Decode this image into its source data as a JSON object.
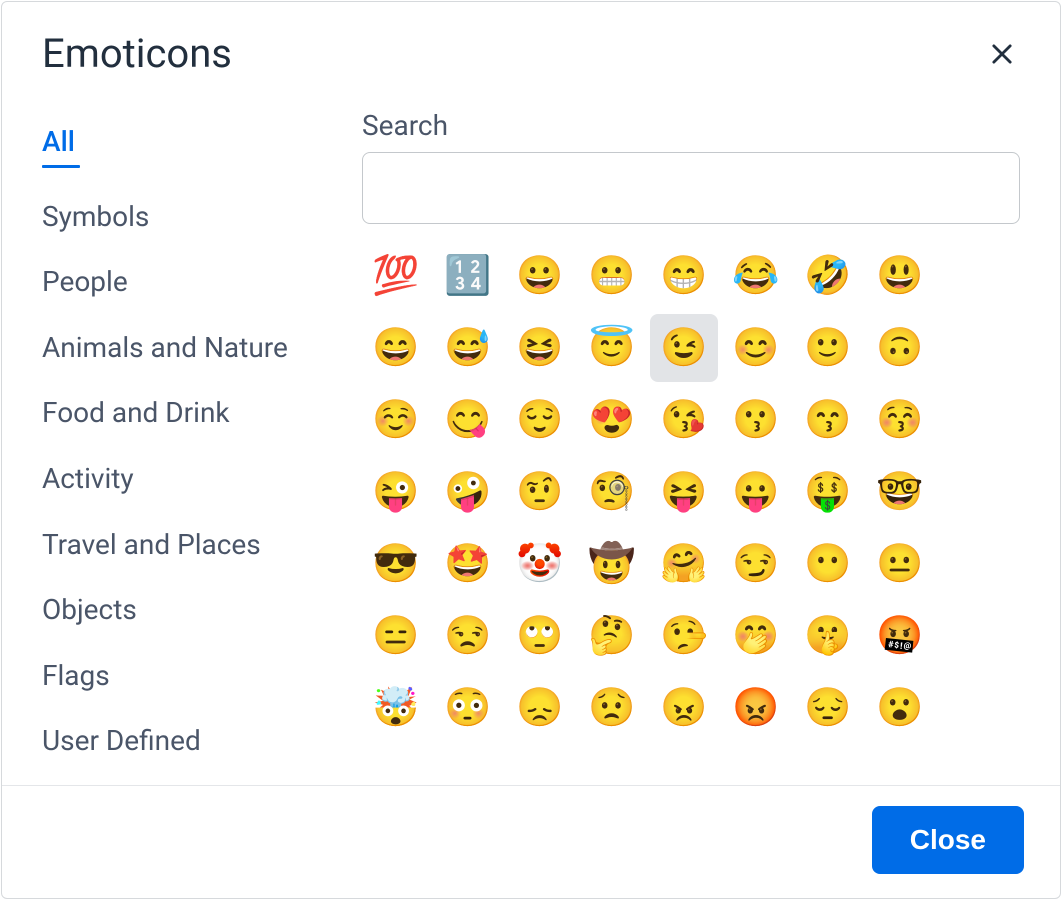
{
  "dialog": {
    "title": "Emoticons",
    "close_button_label": "Close"
  },
  "sidebar": {
    "tabs": [
      {
        "label": "All",
        "active": true
      },
      {
        "label": "Symbols",
        "active": false
      },
      {
        "label": "People",
        "active": false
      },
      {
        "label": "Animals and Nature",
        "active": false
      },
      {
        "label": "Food and Drink",
        "active": false
      },
      {
        "label": "Activity",
        "active": false
      },
      {
        "label": "Travel and Places",
        "active": false
      },
      {
        "label": "Objects",
        "active": false
      },
      {
        "label": "Flags",
        "active": false
      },
      {
        "label": "User Defined",
        "active": false
      }
    ]
  },
  "search": {
    "label": "Search",
    "value": ""
  },
  "emoji_grid": {
    "highlighted_index": 12,
    "items": [
      {
        "char": "💯",
        "name": "hundred-points"
      },
      {
        "char": "🔢",
        "name": "input-numbers"
      },
      {
        "char": "😀",
        "name": "grinning-face"
      },
      {
        "char": "😬",
        "name": "grimacing-face"
      },
      {
        "char": "😁",
        "name": "beaming-face"
      },
      {
        "char": "😂",
        "name": "face-with-tears-of-joy"
      },
      {
        "char": "🤣",
        "name": "rolling-on-the-floor-laughing"
      },
      {
        "char": "😃",
        "name": "grinning-face-big-eyes"
      },
      {
        "char": "😄",
        "name": "grinning-face-smiling-eyes"
      },
      {
        "char": "😅",
        "name": "grinning-face-with-sweat"
      },
      {
        "char": "😆",
        "name": "grinning-squinting-face"
      },
      {
        "char": "😇",
        "name": "smiling-face-with-halo"
      },
      {
        "char": "😉",
        "name": "winking-face"
      },
      {
        "char": "😊",
        "name": "smiling-face-smiling-eyes"
      },
      {
        "char": "🙂",
        "name": "slightly-smiling-face"
      },
      {
        "char": "🙃",
        "name": "upside-down-face"
      },
      {
        "char": "☺️",
        "name": "smiling-face"
      },
      {
        "char": "😋",
        "name": "face-savoring-food"
      },
      {
        "char": "😌",
        "name": "relieved-face"
      },
      {
        "char": "😍",
        "name": "heart-eyes"
      },
      {
        "char": "😘",
        "name": "face-blowing-a-kiss"
      },
      {
        "char": "😗",
        "name": "kissing-face"
      },
      {
        "char": "😙",
        "name": "kissing-smiling-eyes"
      },
      {
        "char": "😚",
        "name": "kissing-closed-eyes"
      },
      {
        "char": "😜",
        "name": "winking-face-with-tongue"
      },
      {
        "char": "🤪",
        "name": "zany-face"
      },
      {
        "char": "🤨",
        "name": "face-with-raised-eyebrow"
      },
      {
        "char": "🧐",
        "name": "face-with-monocle"
      },
      {
        "char": "😝",
        "name": "squinting-face-with-tongue"
      },
      {
        "char": "😛",
        "name": "face-with-tongue"
      },
      {
        "char": "🤑",
        "name": "money-mouth-face"
      },
      {
        "char": "🤓",
        "name": "nerd-face"
      },
      {
        "char": "😎",
        "name": "smiling-face-with-sunglasses"
      },
      {
        "char": "🤩",
        "name": "star-struck"
      },
      {
        "char": "🤡",
        "name": "clown-face"
      },
      {
        "char": "🤠",
        "name": "cowboy-hat-face"
      },
      {
        "char": "🤗",
        "name": "hugging-face"
      },
      {
        "char": "😏",
        "name": "smirking-face"
      },
      {
        "char": "😶",
        "name": "face-without-mouth"
      },
      {
        "char": "😐",
        "name": "neutral-face"
      },
      {
        "char": "😑",
        "name": "expressionless-face"
      },
      {
        "char": "😒",
        "name": "unamused-face"
      },
      {
        "char": "🙄",
        "name": "face-with-rolling-eyes"
      },
      {
        "char": "🤔",
        "name": "thinking-face"
      },
      {
        "char": "🤥",
        "name": "lying-face"
      },
      {
        "char": "🤭",
        "name": "face-with-hand-over-mouth"
      },
      {
        "char": "🤫",
        "name": "shushing-face"
      },
      {
        "char": "🤬",
        "name": "face-with-symbols-on-mouth"
      },
      {
        "char": "🤯",
        "name": "exploding-head"
      },
      {
        "char": "😳",
        "name": "flushed-face"
      },
      {
        "char": "😞",
        "name": "disappointed-face"
      },
      {
        "char": "😟",
        "name": "worried-face"
      },
      {
        "char": "😠",
        "name": "angry-face"
      },
      {
        "char": "😡",
        "name": "pouting-face"
      },
      {
        "char": "😔",
        "name": "pensive-face"
      },
      {
        "char": "😮",
        "name": "face-with-open-mouth"
      }
    ]
  }
}
